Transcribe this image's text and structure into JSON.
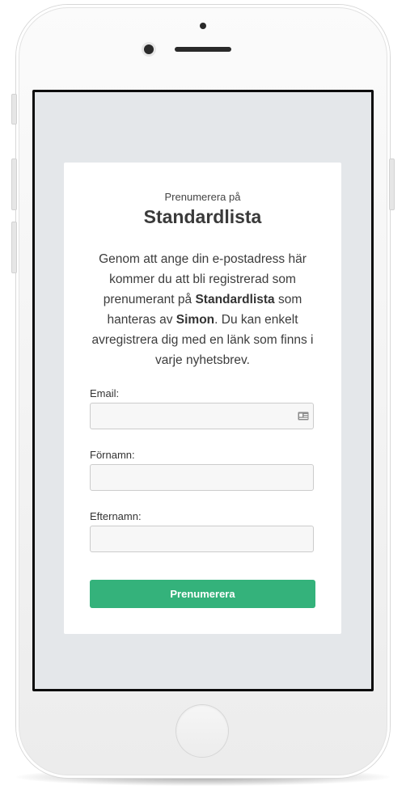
{
  "form": {
    "pre_title": "Prenumerera på",
    "list_name": "Standardlista",
    "description": {
      "part1": "Genom att ange din e-postadress här kommer du att bli registrerad som prenumerant på ",
      "list_name": "Standardlista",
      "part2": " som hanteras av ",
      "owner": "Simon",
      "part3": ". Du kan enkelt avregistrera dig med en länk som finns i varje nyhetsbrev."
    },
    "fields": [
      {
        "label": "Email:",
        "value": "",
        "placeholder": "",
        "icon": "contact-card-icon"
      },
      {
        "label": "Förnamn:",
        "value": "",
        "placeholder": ""
      },
      {
        "label": "Efternamn:",
        "value": "",
        "placeholder": ""
      }
    ],
    "submit_label": "Prenumerera"
  },
  "colors": {
    "screen_background": "#e4e7ea",
    "card_background": "#ffffff",
    "button_background": "#34b27b",
    "button_text": "#ffffff"
  }
}
